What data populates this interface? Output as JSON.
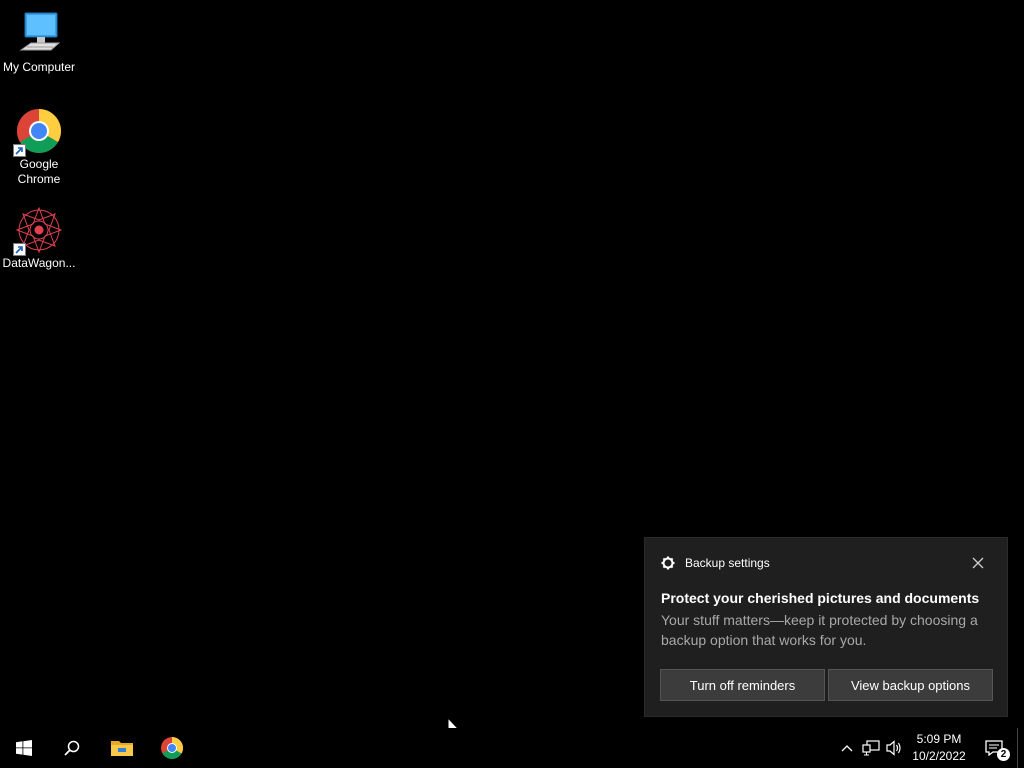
{
  "desktop": {
    "icons": [
      {
        "label": "My Computer",
        "icon": "computer-icon"
      },
      {
        "label": "Google Chrome",
        "icon": "chrome-icon"
      },
      {
        "label": "DataWagon...",
        "icon": "datawagon-icon"
      }
    ]
  },
  "notification": {
    "app_name": "Backup settings",
    "title": "Protect your cherished pictures and documents",
    "body": "Your stuff matters—keep it protected by choosing a backup option that works for you.",
    "buttons": {
      "turn_off": "Turn off reminders",
      "view": "View backup options"
    }
  },
  "taskbar": {
    "pinned": [
      {
        "name": "start",
        "icon": "windows-logo-icon"
      },
      {
        "name": "search",
        "icon": "search-icon"
      },
      {
        "name": "file-explorer",
        "icon": "folder-icon"
      },
      {
        "name": "chrome",
        "icon": "chrome-icon"
      }
    ],
    "tray": {
      "time": "5:09 PM",
      "date": "10/2/2022",
      "notification_count": "2"
    }
  },
  "colors": {
    "desktop_bg": "#000000",
    "toast_bg": "#1f1f1f",
    "button_bg": "#3c3c3c",
    "secondary_text": "#a8a8a8"
  }
}
